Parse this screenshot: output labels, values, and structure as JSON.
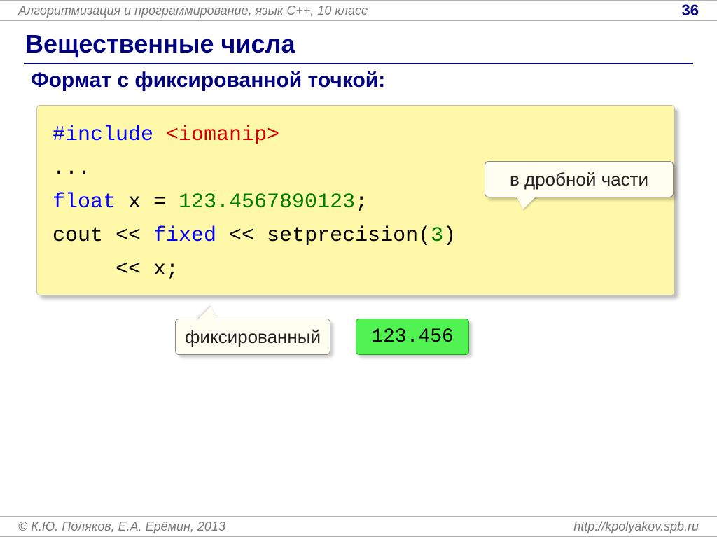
{
  "header": {
    "course": "Алгоритмизация и программирование, язык  C++, 10 класс",
    "page_number": "36"
  },
  "title": "Вещественные числа",
  "subtitle": "Формат с фиксированной точкой:",
  "code": {
    "include_kw": "#include",
    "include_lib": "<iomanip>",
    "ellipsis": "...",
    "float_kw": "float",
    "var_decl": " x = ",
    "float_literal": "123.4567890123",
    "semicolon": ";",
    "cout_pre": "cout << ",
    "fixed_kw": "fixed",
    "cout_mid": " << setprecision(",
    "precision_val": "3",
    "cout_post": ")",
    "last_line_indent": "     << x;"
  },
  "callouts": {
    "fraction_hint": "в дробной части",
    "fixed_hint": "фиксированный"
  },
  "result": "123.456",
  "footer": {
    "copyright": "© К.Ю. Поляков, Е.А. Ерёмин, 2013",
    "url": "http://kpolyakov.spb.ru"
  }
}
